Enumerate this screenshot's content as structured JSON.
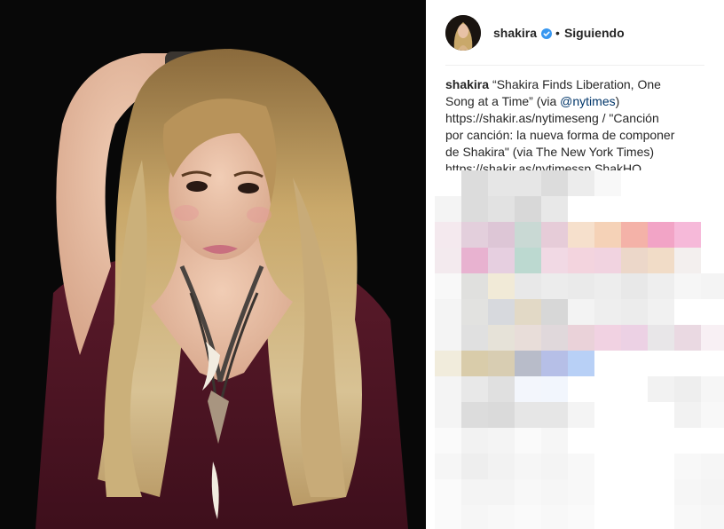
{
  "post": {
    "username": "shakira",
    "follow_label": "Siguiendo",
    "separator": "•",
    "verified_icon": "verified-badge-icon",
    "caption": {
      "username": "shakira",
      "line1": "“Shakira Finds Liberation, One",
      "line2_pre": "Song at a Time” (via ",
      "mention": "@nytimes",
      "line2_post": ")",
      "line3": "https://shakir.as/nytimeseng / \"Canción",
      "line4": "por canción: la nueva forma de componer",
      "line5": "de Shakira\" (via The New York Times)",
      "line6": "https://shakir.as/nytimessp ShakHQ"
    }
  },
  "colors": {
    "accent_link": "#003569",
    "verified_blue": "#3897f0",
    "text": "#262626",
    "divider": "#efefef",
    "photo_bg": "#080808"
  },
  "mosaic_rows": [
    [
      "#ffffff",
      "#dcdcdc",
      "#e6e6e6",
      "#e6e6e6",
      "#dcdcdc",
      "#ececec",
      "#f8f8f8",
      "#ffffff",
      "#ffffff",
      "#ffffff",
      "#ffffff"
    ],
    [
      "#f4f4f4",
      "#dcdcdc",
      "#e2e2e2",
      "#d8d8d8",
      "#e8e8e8",
      "#ffffff",
      "#ffffff",
      "#ffffff",
      "#ffffff",
      "#ffffff",
      "#ffffff"
    ],
    [
      "#f4e9ee",
      "#e3cfdc",
      "#ddc6d6",
      "#c9d9d4",
      "#e6ccd8",
      "#f6e0cc",
      "#f5d2b7",
      "#f4b2a8",
      "#f2a4c6",
      "#f6b9d9",
      "#ffffff"
    ],
    [
      "#f3eaee",
      "#e8b2d0",
      "#e6cfe0",
      "#bcd9d0",
      "#f1d9e4",
      "#f3d4de",
      "#f1d3e0",
      "#ecd7c9",
      "#f1dcc7",
      "#f3efee",
      "#ffffff"
    ],
    [
      "#f8f8f8",
      "#e0e0de",
      "#f1ead7",
      "#e8e8e8",
      "#ececec",
      "#eaeaea",
      "#ededed",
      "#e8e8e8",
      "#eeeeee",
      "#f6f6f6",
      "#f4f4f4"
    ],
    [
      "#f4f4f4",
      "#e2e2e0",
      "#d7d9dd",
      "#e2d9c6",
      "#d7d7d7",
      "#f3f3f3",
      "#eeeeee",
      "#ececec",
      "#f1f1f1",
      "#ffffff",
      "#ffffff"
    ],
    [
      "#f4f4f4",
      "#e0e0e0",
      "#e6e2d8",
      "#e8ddd9",
      "#e0d8db",
      "#ead2d9",
      "#f1d2e2",
      "#ecd1e4",
      "#e8e6e8",
      "#ead9e2",
      "#f8f0f4"
    ],
    [
      "#f1ecdc",
      "#d9ccaa",
      "#d8cdb2",
      "#b8bcc9",
      "#b6bfe7",
      "#b8d0f6",
      "#ffffff",
      "#ffffff",
      "#ffffff",
      "#ffffff",
      "#ffffff"
    ],
    [
      "#f4f4f4",
      "#e8e8e8",
      "#e0e0e0",
      "#f3f6fc",
      "#f2f6fd",
      "#ffffff",
      "#ffffff",
      "#ffffff",
      "#f2f2f2",
      "#eeeeee",
      "#f6f6f6"
    ],
    [
      "#f4f4f4",
      "#dcdcdc",
      "#dadada",
      "#e6e6e6",
      "#e6e6e6",
      "#f4f4f4",
      "#ffffff",
      "#ffffff",
      "#ffffff",
      "#f2f2f2",
      "#f8f8f8"
    ],
    [
      "#fafafa",
      "#f2f2f2",
      "#f4f4f4",
      "#fafafa",
      "#f6f6f6",
      "#ffffff",
      "#ffffff",
      "#ffffff",
      "#ffffff",
      "#ffffff",
      "#ffffff"
    ],
    [
      "#f6f6f6",
      "#eeeeee",
      "#f2f2f2",
      "#f6f6f6",
      "#f4f4f4",
      "#f8f8f8",
      "#ffffff",
      "#ffffff",
      "#ffffff",
      "#f8f8f8",
      "#f6f6f6"
    ],
    [
      "#fafafa",
      "#f4f4f4",
      "#f4f4f4",
      "#f8f8f8",
      "#f6f6f6",
      "#f8f8f8",
      "#ffffff",
      "#ffffff",
      "#ffffff",
      "#f6f6f6",
      "#f4f4f4"
    ],
    [
      "#fafafa",
      "#f6f6f6",
      "#f8f8f8",
      "#fafafa",
      "#f8f8f8",
      "#fafafa",
      "#ffffff",
      "#ffffff",
      "#ffffff",
      "#f8f8f8",
      "#f6f6f6"
    ]
  ]
}
